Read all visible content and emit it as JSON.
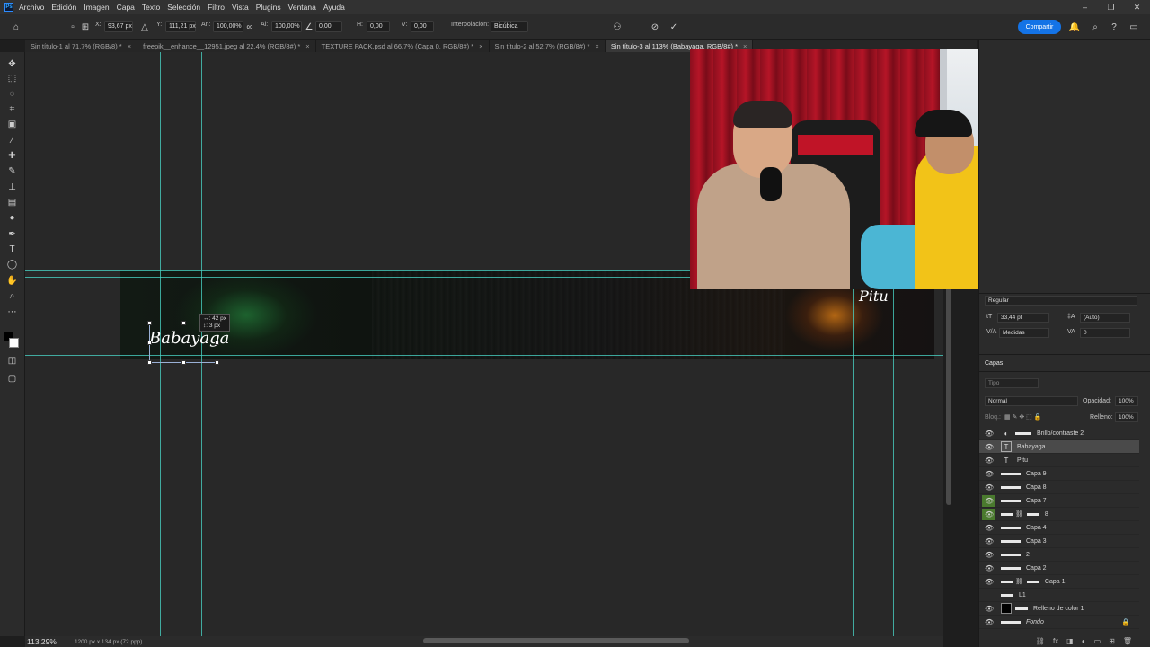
{
  "app": {
    "logo_text": "Ps"
  },
  "menu": [
    "Archivo",
    "Edición",
    "Imagen",
    "Capa",
    "Texto",
    "Selección",
    "Filtro",
    "Vista",
    "Plugins",
    "Ventana",
    "Ayuda"
  ],
  "window_controls": {
    "minimize": "–",
    "restore": "❐",
    "close": "✕"
  },
  "options": {
    "x_label": "X:",
    "x_value": "93,67 px",
    "y_label": "Y:",
    "y_value": "111,21 px",
    "w_label": "An:",
    "w_value": "100,00%",
    "h_label": "Al:",
    "h_value": "100,00%",
    "angle_value": "0,00",
    "hskew_label": "H:",
    "hskew_value": "0,00",
    "vskew_label": "V:",
    "vskew_value": "0,00",
    "interp_label": "Interpolación:",
    "interp_value": "Bicúbica",
    "share_label": "Compartir"
  },
  "tabs": [
    {
      "label": "Sin título-1 al 71,7% (RGB/8) *",
      "active": false
    },
    {
      "label": "freepik__enhance__12951.jpeg al 22,4% (RGB/8#) *",
      "active": false
    },
    {
      "label": "TEXTURE PACK.psd al 66,7% (Capa 0, RGB/8#) *",
      "active": false
    },
    {
      "label": "Sin título-2 al 52,7% (RGB/8#) *",
      "active": false
    },
    {
      "label": "Sin título-3 al 113% (Babayaga, RGB/8#) *",
      "active": true
    }
  ],
  "tab_close": "×",
  "canvas": {
    "babayaga_text": "Babayaga",
    "pitu_text": "Pitu",
    "measure_w": "↔: 42 px",
    "measure_h": "↕: 3 px"
  },
  "status": {
    "zoom": "113,29%",
    "doc_size": "1200 px x 134 px (72 ppp)"
  },
  "properties": {
    "font_style": "Regular",
    "font_size": "33,44 pt",
    "leading": "(Auto)",
    "kerning": "Medidas",
    "tracking": "0"
  },
  "layers_panel": {
    "title": "Capas",
    "search_placeholder": "Tipo",
    "blend_mode": "Normal",
    "opacity_label": "Opacidad:",
    "opacity_value": "100%",
    "lock_label": "Bloq.:",
    "fill_label": "Relleno:",
    "fill_value": "100%"
  },
  "layers": [
    {
      "name": "Brillo/contraste 2",
      "kind": "adjustment",
      "selected": false
    },
    {
      "name": "Babayaga",
      "kind": "text",
      "selected": true
    },
    {
      "name": "Pitu",
      "kind": "text",
      "selected": false
    },
    {
      "name": "Capa 9",
      "kind": "pixel",
      "selected": false
    },
    {
      "name": "Capa 8",
      "kind": "pixel",
      "selected": false
    },
    {
      "name": "Capa 7",
      "kind": "pixel",
      "selected": false
    },
    {
      "name": "8",
      "kind": "masked",
      "selected": false
    },
    {
      "name": "Capa 4",
      "kind": "pixel",
      "selected": false
    },
    {
      "name": "Capa 3",
      "kind": "pixel",
      "selected": false
    },
    {
      "name": "2",
      "kind": "pixel",
      "selected": false
    },
    {
      "name": "Capa 2",
      "kind": "pixel",
      "selected": false
    },
    {
      "name": "Capa 1",
      "kind": "masked",
      "selected": false
    },
    {
      "name": "L1",
      "kind": "pixel",
      "selected": false
    },
    {
      "name": "Relleno de color 1",
      "kind": "fill",
      "selected": false
    },
    {
      "name": "Fondo",
      "kind": "background",
      "selected": false
    }
  ],
  "colors": {
    "accent": "#1473e6",
    "guide": "#4ad7c8",
    "highlight_eye": "#4a7a2e"
  }
}
